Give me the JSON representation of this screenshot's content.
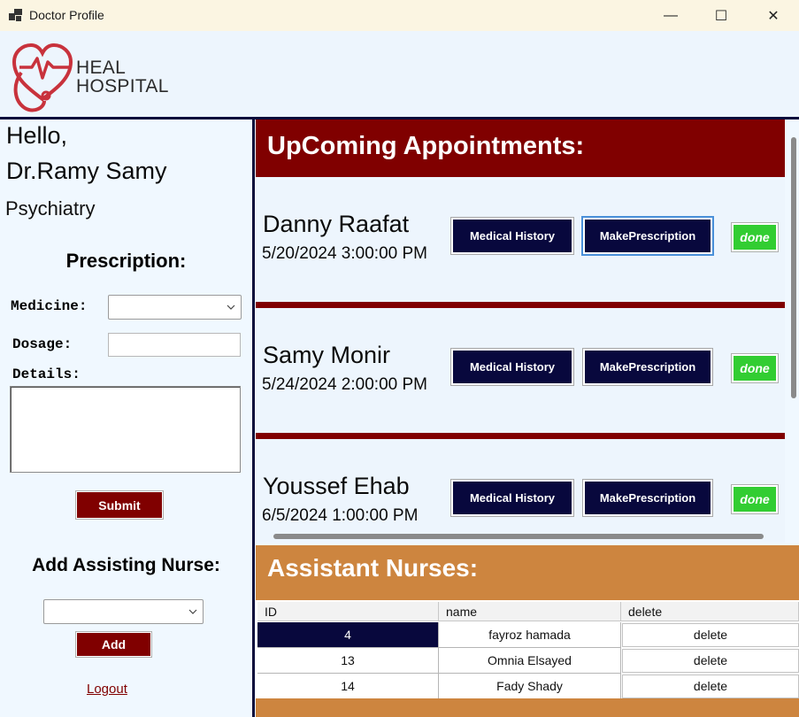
{
  "window": {
    "title": "Doctor Profile",
    "minimize": "—",
    "maximize": "☐",
    "close": "✕"
  },
  "logo": {
    "line1": "HEAL",
    "line2": "HOSPITAL"
  },
  "doctor": {
    "greeting": "Hello,",
    "name": "Dr.Ramy Samy",
    "specialty": "Psychiatry"
  },
  "prescription": {
    "title": "Prescription:",
    "medicine_label": "Medicine:",
    "medicine_value": "",
    "dosage_label": "Dosage:",
    "dosage_value": "",
    "details_label": "Details:",
    "details_value": "",
    "submit_label": "Submit"
  },
  "nurse_form": {
    "title": "Add Assisting Nurse:",
    "selected": "",
    "add_label": "Add"
  },
  "logout_label": "Logout",
  "appointments": {
    "title": "UpComing Appointments:",
    "history_label": "Medical History",
    "prescription_label": "MakePrescription",
    "done_label": "done",
    "items": [
      {
        "patient": "Danny  Raafat",
        "datetime": "5/20/2024 3:00:00 PM"
      },
      {
        "patient": "Samy Monir",
        "datetime": "5/24/2024 2:00:00 PM"
      },
      {
        "patient": "Youssef Ehab",
        "datetime": "6/5/2024 1:00:00 PM"
      }
    ]
  },
  "nurses": {
    "title": "Assistant Nurses:",
    "columns": [
      "ID",
      "name",
      "delete"
    ],
    "rows": [
      {
        "id": "4",
        "name": "fayroz hamada",
        "action": "delete"
      },
      {
        "id": "13",
        "name": "Omnia Elsayed",
        "action": "delete"
      },
      {
        "id": "14",
        "name": "Fady Shady",
        "action": "delete"
      }
    ]
  },
  "colors": {
    "maroon": "#800000",
    "navy": "#08083d",
    "green": "#32cd32",
    "peru": "#cd853f",
    "background": "#f0f8ff"
  }
}
